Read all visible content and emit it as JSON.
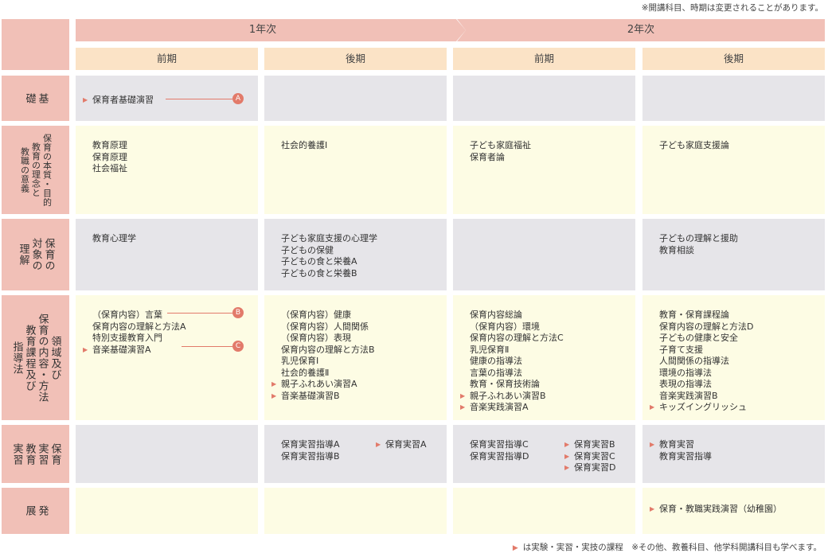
{
  "note_top": "※開講科目、時期は変更されることがあります。",
  "years": [
    "1年次",
    "2年次"
  ],
  "terms": [
    "前期",
    "後期",
    "前期",
    "後期"
  ],
  "categories": [
    {
      "cols": [
        "基",
        "礎"
      ]
    },
    {
      "cols": [
        "保育の本質・目的",
        "教育の理念と",
        "教職の意義"
      ]
    },
    {
      "cols": [
        "保育の",
        "対象の",
        "理解"
      ]
    },
    {
      "cols": [
        "領域及び",
        "保育の内容・方法",
        "教育課程及び",
        "指導法"
      ]
    },
    {
      "cols": [
        "保育",
        "実習",
        "教育",
        "実習"
      ]
    },
    {
      "cols": [
        "発",
        "展"
      ]
    }
  ],
  "rows": [
    [
      [
        {
          "text": "保育者基礎演習",
          "practical": true,
          "marker": "A"
        }
      ],
      [],
      [],
      []
    ],
    [
      [
        {
          "text": "教育原理"
        },
        {
          "text": "保育原理"
        },
        {
          "text": "社会福祉"
        }
      ],
      [
        {
          "text": "社会的養護Ⅰ"
        }
      ],
      [
        {
          "text": "子ども家庭福祉"
        },
        {
          "text": "保育者論"
        }
      ],
      [
        {
          "text": "子ども家庭支援論"
        }
      ]
    ],
    [
      [
        {
          "text": "教育心理学"
        }
      ],
      [
        {
          "text": "子ども家庭支援の心理学"
        },
        {
          "text": "子どもの保健"
        },
        {
          "text": "子どもの食と栄養A"
        },
        {
          "text": "子どもの食と栄養B"
        }
      ],
      [],
      [
        {
          "text": "子どもの理解と援助"
        },
        {
          "text": "教育相談"
        }
      ]
    ],
    [
      [
        {
          "text": "（保育内容）言葉",
          "marker": "B"
        },
        {
          "text": "保育内容の理解と方法A"
        },
        {
          "text": "特別支援教育入門"
        },
        {
          "text": "音楽基礎演習A",
          "practical": true,
          "marker": "C"
        }
      ],
      [
        {
          "text": "（保育内容）健康"
        },
        {
          "text": "（保育内容）人間関係"
        },
        {
          "text": "（保育内容）表現"
        },
        {
          "text": "保育内容の理解と方法B"
        },
        {
          "text": "乳児保育Ⅰ"
        },
        {
          "text": "社会的養護Ⅱ"
        },
        {
          "text": "親子ふれあい演習A",
          "practical": true
        },
        {
          "text": "音楽基礎演習B",
          "practical": true
        }
      ],
      [
        {
          "text": "保育内容総論"
        },
        {
          "text": "（保育内容）環境"
        },
        {
          "text": "保育内容の理解と方法C"
        },
        {
          "text": "乳児保育Ⅱ"
        },
        {
          "text": "健康の指導法"
        },
        {
          "text": "言葉の指導法"
        },
        {
          "text": "教育・保育技術論"
        },
        {
          "text": "親子ふれあい演習B",
          "practical": true
        },
        {
          "text": "音楽実践演習A",
          "practical": true
        }
      ],
      [
        {
          "text": "教育・保育課程論"
        },
        {
          "text": "保育内容の理解と方法D"
        },
        {
          "text": "子どもの健康と安全"
        },
        {
          "text": "子育て支援"
        },
        {
          "text": "人間関係の指導法"
        },
        {
          "text": "環境の指導法"
        },
        {
          "text": "表現の指導法"
        },
        {
          "text": "音楽実践演習B"
        },
        {
          "text": "キッズイングリッシュ",
          "practical": true
        }
      ]
    ],
    [
      [],
      [
        {
          "text": "保育実習指導A"
        },
        {
          "text": "保育実習指導B"
        },
        {
          "text": "保育実習A",
          "practical": true,
          "col2": true
        }
      ],
      [
        {
          "text": "保育実習指導C"
        },
        {
          "text": "保育実習指導D"
        },
        {
          "text": "保育実習B",
          "practical": true,
          "col2": true
        },
        {
          "text": "保育実習C",
          "practical": true,
          "col2": true
        },
        {
          "text": "保育実習D",
          "practical": true,
          "col2": true
        }
      ],
      [
        {
          "text": "教育実習",
          "practical": true
        },
        {
          "text": "教育実習指導"
        }
      ]
    ],
    [
      [],
      [],
      [],
      [
        {
          "text": "保育・教職実践演習（幼稚園）",
          "practical": true
        }
      ]
    ]
  ],
  "note_bottom": "は実験・実習・実技の課程　※その他、教養科目、他学科開講科目も学べます。",
  "colors": {
    "pink": "#f1c0b7",
    "gray": "#e6e5e9",
    "yellow": "#fdfce4",
    "peach": "#fbe3c6",
    "accent": "#e27a6a"
  }
}
